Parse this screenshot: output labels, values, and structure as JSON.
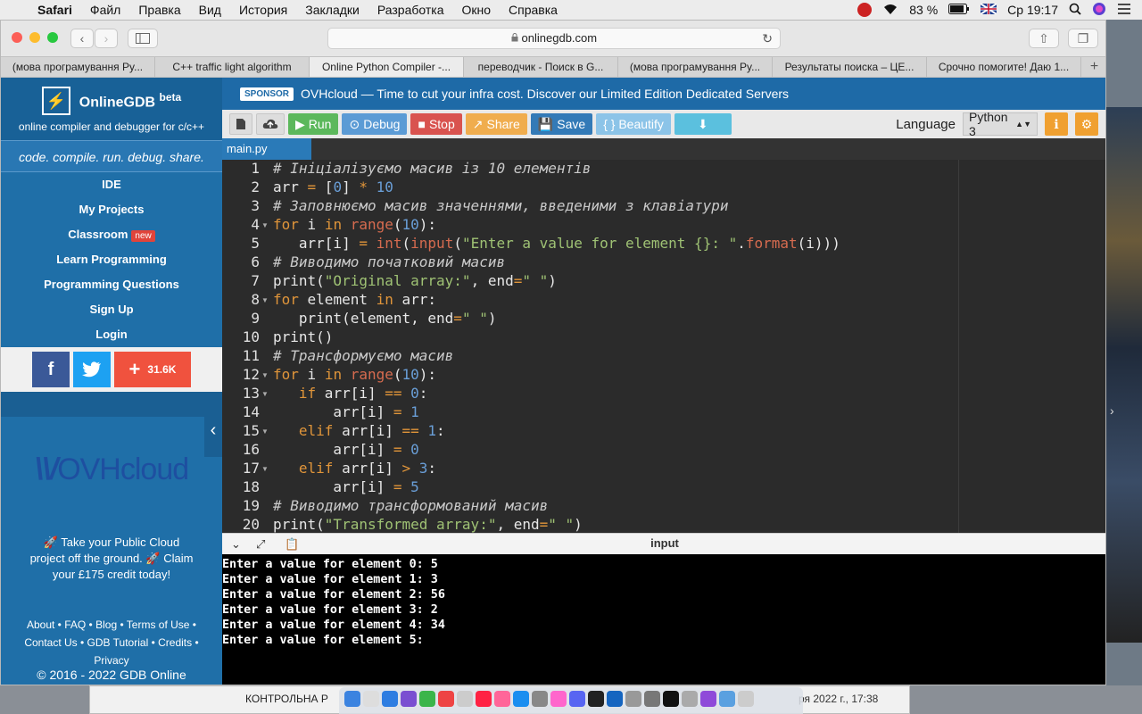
{
  "menubar": {
    "app": "Safari",
    "items": [
      "Файл",
      "Правка",
      "Вид",
      "История",
      "Закладки",
      "Разработка",
      "Окно",
      "Справка"
    ],
    "battery": "83 %",
    "clock": "Ср 19:17"
  },
  "browser": {
    "url": "onlinegdb.com",
    "tabs": [
      {
        "label": "(мова програмування Py...",
        "active": false
      },
      {
        "label": "C++ traffic light algorithm",
        "active": false
      },
      {
        "label": "Online Python Compiler -...",
        "active": true
      },
      {
        "label": "переводчик - Поиск в G...",
        "active": false
      },
      {
        "label": "(мова програмування Py...",
        "active": false
      },
      {
        "label": "Результаты поиска – ЦЕ...",
        "active": false
      },
      {
        "label": "Срочно помогите! Даю 1...",
        "active": false
      }
    ],
    "new_tab": "+"
  },
  "sidebar": {
    "brand": "OnlineGDB",
    "brand_sup": "beta",
    "brand_sub": "online compiler and debugger for c/c++",
    "tagline": "code. compile. run. debug. share.",
    "nav": [
      {
        "label": "IDE"
      },
      {
        "label": "My Projects"
      },
      {
        "label": "Classroom",
        "badge": "new"
      },
      {
        "label": "Learn Programming"
      },
      {
        "label": "Programming Questions"
      },
      {
        "label": "Sign Up"
      },
      {
        "label": "Login"
      }
    ],
    "social": {
      "share_count": "31.6K"
    },
    "ad_logo": "OVHcloud",
    "promo": "🚀 Take your Public Cloud project off the ground. 🚀 Claim your £175 credit today!",
    "footer_links": [
      "About",
      "FAQ",
      "Blog",
      "Terms of Use",
      "Contact Us",
      "GDB Tutorial",
      "Credits",
      "Privacy"
    ],
    "copyright": "© 2016 - 2022 GDB Online"
  },
  "sponsor": {
    "badge": "SPONSOR",
    "text": "OVHcloud — Time to cut your infra cost. Discover our Limited Edition Dedicated Servers"
  },
  "ide_toolbar": {
    "run": "Run",
    "debug": "Debug",
    "stop": "Stop",
    "share": "Share",
    "save": "Save",
    "beautify": "{ } Beautify",
    "language_label": "Language",
    "language_value": "Python 3"
  },
  "file_tab": "main.py",
  "editor": {
    "line_numbers": [
      "1",
      "2",
      "3",
      "4",
      "5",
      "6",
      "7",
      "8",
      "9",
      "10",
      "11",
      "12",
      "13",
      "14",
      "15",
      "16",
      "17",
      "18",
      "19",
      "20"
    ],
    "lines": [
      "# Ініціалізуємо масив із 10 елементів",
      "arr = [0] * 10",
      "# Заповнюємо масив значеннями, введеними з клавіатури",
      "for i in range(10):",
      "   arr[i] = int(input(\"Enter a value for element {}: \".format(i)))",
      "# Виводимо початковий масив",
      "print(\"Original array:\", end=\" \")",
      "for element in arr:",
      "   print(element, end=\" \")",
      "print()",
      "# Трансформуємо масив",
      "for i in range(10):",
      "   if arr[i] == 0:",
      "       arr[i] = 1",
      "   elif arr[i] == 1:",
      "       arr[i] = 0",
      "   elif arr[i] > 3:",
      "       arr[i] = 5",
      "# Виводимо трансформований масив",
      "print(\"Transformed array:\", end=\" \")"
    ]
  },
  "io": {
    "title": "input",
    "console": [
      "Enter a value for element 0: 5",
      "Enter a value for element 1: 3",
      "Enter a value for element 2: 56",
      "Enter a value for element 3: 2",
      "Enter a value for element 4: 34",
      "Enter a value for element 5: "
    ]
  },
  "background": {
    "behind_row": "КОНТРОЛЬНА Р",
    "behind_date": "ря 2022 г., 17:38"
  }
}
